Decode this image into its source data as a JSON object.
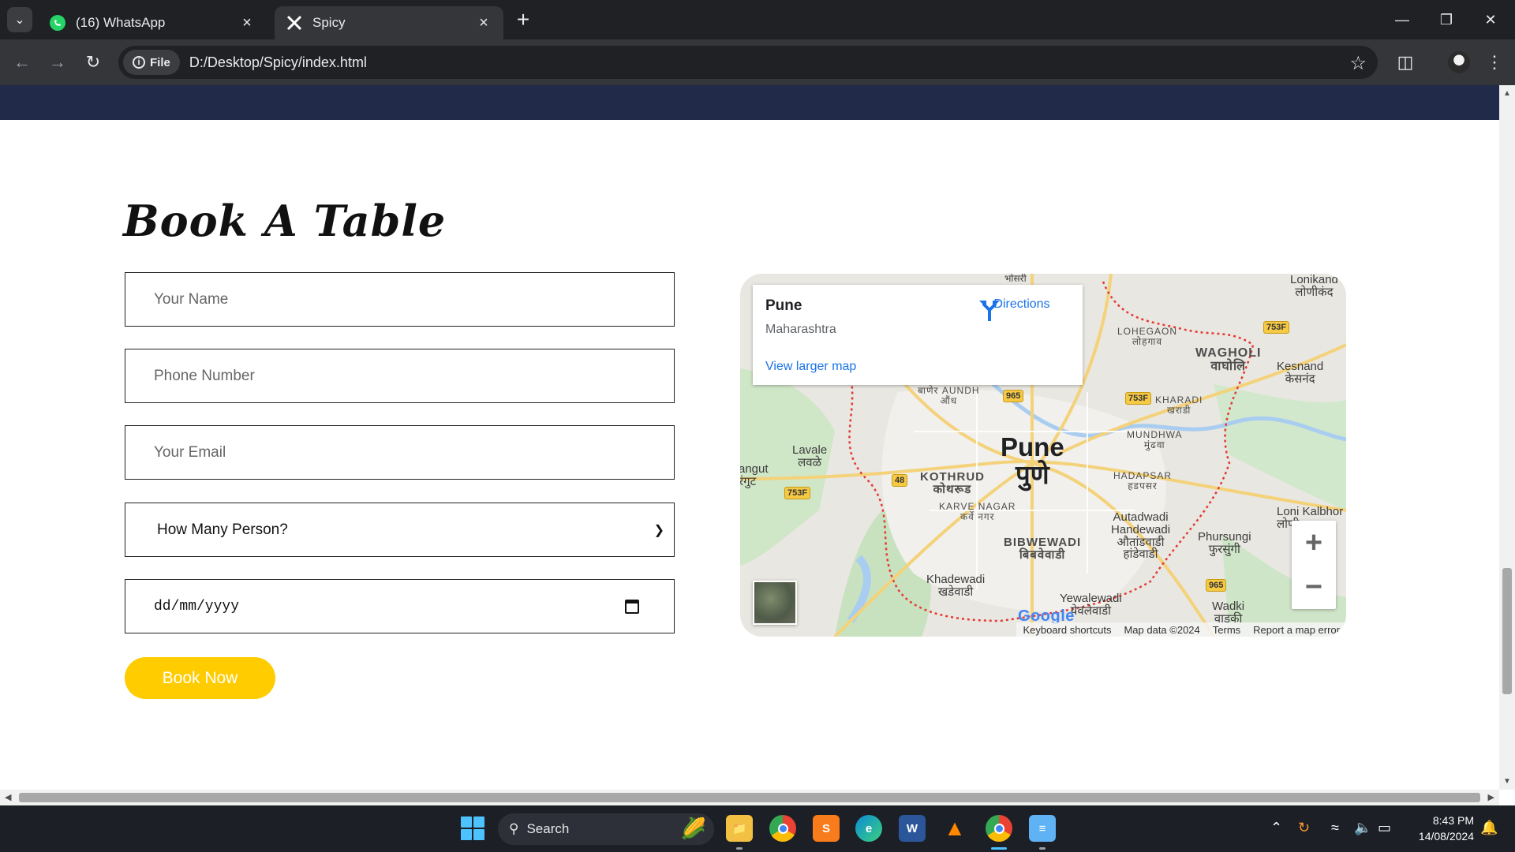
{
  "browser": {
    "tabs": [
      {
        "title": "(16) WhatsApp",
        "icon": "whatsapp-icon",
        "active": false
      },
      {
        "title": "Spicy",
        "icon": "spicy-x-icon",
        "active": true
      }
    ],
    "omnibox": {
      "chip_label": "File",
      "url": "D:/Desktop/Spicy/index.html"
    }
  },
  "page": {
    "section_title": "Book A Table",
    "form": {
      "name_placeholder": "Your Name",
      "phone_placeholder": "Phone Number",
      "email_placeholder": "Your Email",
      "persons_selected": "How Many Person?",
      "date_value": "dd/mm/yyyy",
      "submit_label": "Book Now"
    },
    "map": {
      "card": {
        "place": "Pune",
        "region": "Maharashtra",
        "directions_label": "Directions",
        "larger_map_label": "View larger map"
      },
      "labels": {
        "pune": "Pune",
        "pune_mr": "पुणे",
        "kothrud": "KOTHRUD",
        "kothrud_mr": "कोथरूड",
        "karve_nagar": "KARVE NAGAR",
        "karve_nagar_mr": "कर्वे नगर",
        "bibwewadi": "BIBWEWADI",
        "bibwewadi_mr": "बिबवेवाडी",
        "lavale": "Lavale",
        "lavale_mr": "लवळे",
        "angut": "angut",
        "angut_mr": "रंगुट",
        "aundh": "AUNDH",
        "aundh_mr": "औंध",
        "baner_mr": "बाणेर",
        "lohegaon": "LOHEGAON",
        "lohegaon_mr": "लोहगाव",
        "wagholi": "WAGHOLI",
        "wagholi_mr": "वाघोलि",
        "kesnand": "Kesnand",
        "kesnand_mr": "केसनंद",
        "lonikand": "Lonikand",
        "lonikand_mr": "लोणीकंद",
        "kharadi": "KHARADI",
        "kharadi_mr": "खराडी",
        "mundhwa": "MUNDHWA",
        "mundhwa_mr": "मुंढवा",
        "hadapsar": "HADAPSAR",
        "hadapsar_mr": "हडपसर",
        "autadwadi": "Autadwadi",
        "handewadi": "Handewadi",
        "autadwadi_mr": "औतांडवाडी",
        "handewadi_mr": "हांडेवाडी",
        "phursungi": "Phursungi",
        "phursungi_mr": "फुरसुंगी",
        "loni_kalbhor": "Loni Kalbhor",
        "loni_mr": "लोणी",
        "khadewadi": "Khadewadi",
        "khadewadi_mr": "खडेवाडी",
        "yewalewadi": "Yewalewadi",
        "yewalewadi_mr": "येवलेवाडी",
        "wadki": "Wadki",
        "wadki_mr": "वाडकी",
        "bhosari_mr": "भोसरी"
      },
      "shields": [
        "753F",
        "753F",
        "965",
        "965",
        "48",
        "753F"
      ],
      "google_logo": "Google",
      "footer": [
        "Keyboard shortcuts",
        "Map data ©2024",
        "Terms",
        "Report a map error"
      ]
    }
  },
  "taskbar": {
    "search_label": "Search",
    "clock_time": "8:43 PM",
    "clock_date": "14/08/2024"
  },
  "colors": {
    "navbar": "#222a4a",
    "accent_button": "#ffcc00",
    "link_blue": "#1a73e8"
  }
}
